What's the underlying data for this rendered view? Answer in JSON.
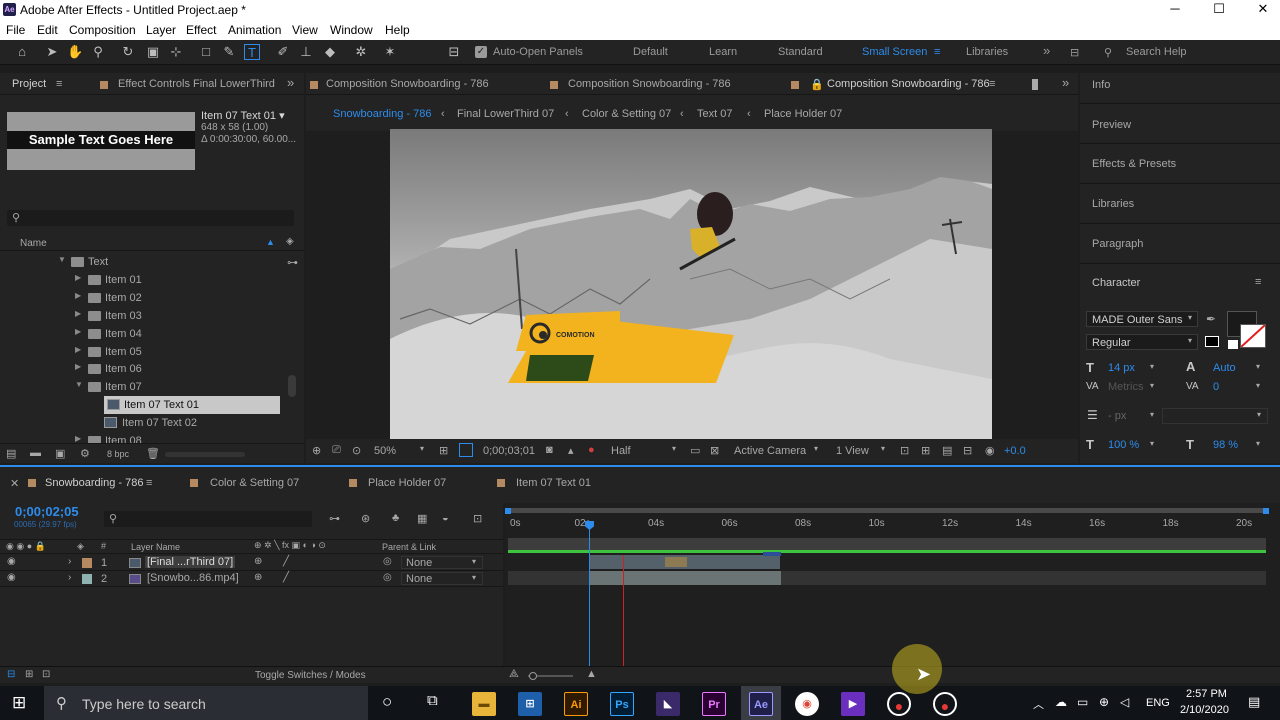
{
  "app": {
    "title": "Adobe After Effects - Untitled Project.aep *",
    "menu": [
      "File",
      "Edit",
      "Composition",
      "Layer",
      "Effect",
      "Animation",
      "View",
      "Window",
      "Help"
    ],
    "window_controls": [
      "─",
      "☐",
      "✕"
    ]
  },
  "toolbar": {
    "auto_open_panels": "Auto-Open Panels",
    "workspaces": [
      "Default",
      "Learn",
      "Standard",
      "Small Screen",
      "Libraries"
    ],
    "active_workspace": "Small Screen",
    "search_help": "Search Help"
  },
  "project_panel": {
    "tabs": [
      "Project",
      "Effect Controls Final LowerThird"
    ],
    "thumb_text": "Sample Text Goes Here",
    "item_name": "Item 07 Text 01 ▾",
    "item_dims": "648 x 58 (1.00)",
    "item_duration": "Δ 0:00:30:00, 60.00...",
    "column_name": "Name",
    "tree": [
      {
        "label": "Text",
        "kind": "folder",
        "indent": 0,
        "open": true
      },
      {
        "label": "Item 01",
        "kind": "folder",
        "indent": 1,
        "open": false
      },
      {
        "label": "Item 02",
        "kind": "folder",
        "indent": 1,
        "open": false
      },
      {
        "label": "Item 03",
        "kind": "folder",
        "indent": 1,
        "open": false
      },
      {
        "label": "Item 04",
        "kind": "folder",
        "indent": 1,
        "open": false
      },
      {
        "label": "Item 05",
        "kind": "folder",
        "indent": 1,
        "open": false
      },
      {
        "label": "Item 06",
        "kind": "folder",
        "indent": 1,
        "open": false
      },
      {
        "label": "Item 07",
        "kind": "folder",
        "indent": 1,
        "open": true
      },
      {
        "label": "Item 07 Text 01",
        "kind": "comp",
        "indent": 2,
        "selected": true
      },
      {
        "label": "Item 07 Text 02",
        "kind": "comp",
        "indent": 2
      },
      {
        "label": "Item 08",
        "kind": "folder",
        "indent": 1,
        "open": false
      }
    ],
    "bpc": "8 bpc"
  },
  "comp_panel": {
    "tabs": [
      "Composition Snowboarding - 786",
      "Composition Snowboarding - 786",
      "Composition Snowboarding - 786"
    ],
    "breadcrumbs": [
      "Snowboarding - 786",
      "Final LowerThird 07",
      "Color & Setting 07",
      "Text 07",
      "Place Holder 07"
    ],
    "overlay_brand": "COMOTION",
    "zoom": "50%",
    "timecode": "0;00;03;01",
    "resolution": "Half",
    "camera": "Active Camera",
    "views": "1 View",
    "exposure": "+0.0"
  },
  "right_panel": {
    "items": [
      "Info",
      "Preview",
      "Effects & Presets",
      "Libraries",
      "Paragraph",
      "Character"
    ],
    "font": "MADE Outer Sans",
    "style": "Regular",
    "font_size": "14 px",
    "leading": "Auto",
    "kerning": "Metrics",
    "tracking": "0",
    "stroke_unit": "- px",
    "vscale": "100 %",
    "hscale": "98 %"
  },
  "timeline": {
    "tabs": [
      "Snowboarding - 786",
      "Color & Setting 07",
      "Place Holder 07",
      "Item 07 Text 01"
    ],
    "timecode": "0;00;02;05",
    "fps": "00065 (29.97 fps)",
    "col_layer_name": "Layer Name",
    "col_parent": "Parent & Link",
    "ruler": [
      "0s",
      "02s",
      "04s",
      "06s",
      "08s",
      "10s",
      "12s",
      "14s",
      "16s",
      "18s",
      "20s"
    ],
    "layers": [
      {
        "num": "1",
        "name": "[Final ...rThird 07]",
        "parent": "None",
        "color": "#b58a61"
      },
      {
        "num": "2",
        "name": "[Snowbo...86.mp4]",
        "parent": "None",
        "color": "#8fb3b1"
      }
    ],
    "toggle_label": "Toggle Switches / Modes"
  },
  "taskbar": {
    "search_placeholder": "Type here to search",
    "lang": "ENG",
    "time": "2:57 PM",
    "date": "2/10/2020",
    "apps": [
      "Ai",
      "Ps",
      "Pr",
      "Ae"
    ]
  },
  "colors": {
    "accent": "#2d8ceb",
    "overlay_yellow": "#f2b31e",
    "overlay_green": "#2d4a19",
    "ae_purple": "#9999ff"
  }
}
